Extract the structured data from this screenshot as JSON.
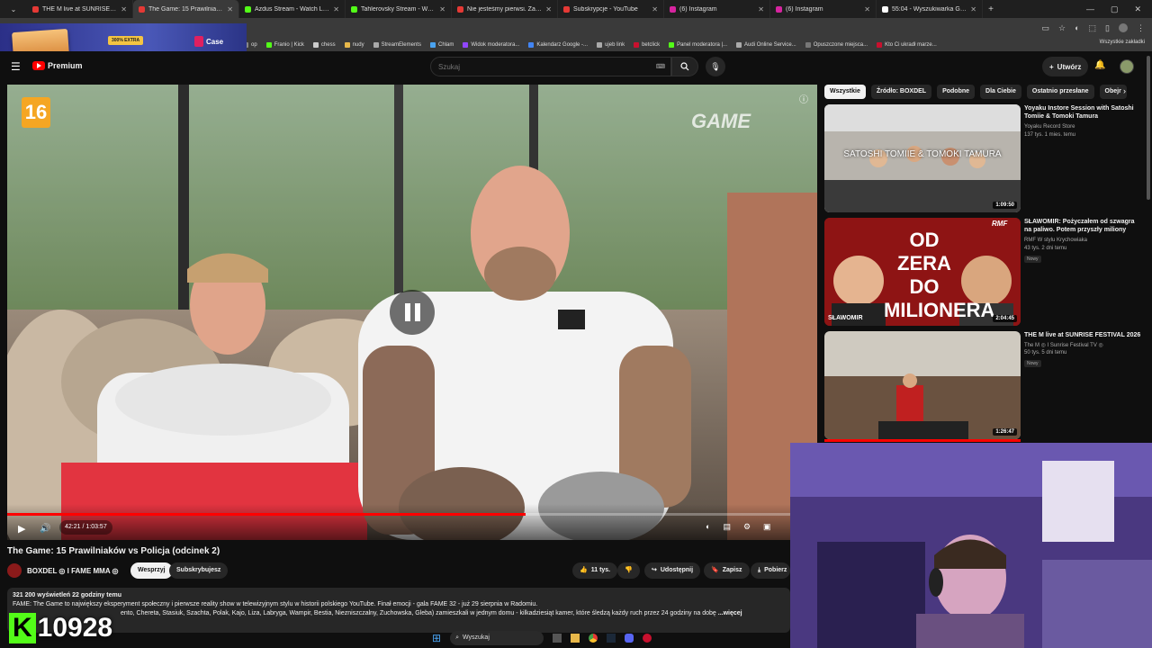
{
  "browser": {
    "tabs": [
      {
        "title": "THE M live at SUNRISE FESTIVAL",
        "color": "#e53935",
        "active": false
      },
      {
        "title": "The Game: 15 Prawilniaków",
        "color": "#e53935",
        "active": true
      },
      {
        "title": "Azdus Stream - Watch Live on",
        "color": "#53fc18",
        "active": false
      },
      {
        "title": "Tahlerovsky Stream - Watch Li",
        "color": "#53fc18",
        "active": false
      },
      {
        "title": "Nie jesteśmy pierwsi. Zaawans",
        "color": "#e53935",
        "active": false
      },
      {
        "title": "Subskrypcje - YouTube",
        "color": "#e53935",
        "active": false
      },
      {
        "title": "(6) Instagram",
        "color": "#d6249f",
        "active": false
      },
      {
        "title": "(6) Instagram",
        "color": "#d6249f",
        "active": false
      },
      {
        "title": "55:04 - Wyszukiwarka Google",
        "color": "#ffffff",
        "active": false
      }
    ],
    "bookmarks": [
      "op",
      "Franio | Kick",
      "chess",
      "nudy",
      "StreamElements",
      "Chlam",
      "Widok moderatora...",
      "Kalendarz Google -...",
      "ujeb link",
      "betclick",
      "Panel moderatora |...",
      "Audi Online Service...",
      "Opuszczone miejsca...",
      "Kto Ci ukradł marze..."
    ],
    "bookmarks_right": "Wszystkie zakładki"
  },
  "ad": {
    "badge": "300% EXTRA",
    "brand": "Case"
  },
  "youtube": {
    "logo": "Premium",
    "search_placeholder": "Szukaj",
    "create_label": "Utwórz"
  },
  "player": {
    "age_rating": "16",
    "watermark": "GAME",
    "time": "42:21 / 1:03:57",
    "progress": 0.662
  },
  "video": {
    "title": "The Game: 15 Prawilniaków vs Policja (odcinek 2)",
    "channel": "BOXDEL ◎ I FAME MMA ◎",
    "support_label": "Wesprzyj",
    "subscribed_label": "Subskrybujesz",
    "likes": "11 tys.",
    "share_label": "Udostępnij",
    "save_label": "Zapisz",
    "download_label": "Pobierz",
    "stats": "321 200 wyświetleń  22 godziny temu",
    "desc_line1": "FAME: The Game to największy eksperyment społeczny i pierwsze reality show w telewizyjnym stylu w historii polskiego YouTube. Finał emocji - gala FAME 32 - już 29 sierpnia w Radomiu.",
    "desc_line2": "ento, Chereta, Stasiuk, Szachta, Polak, Kajo, Liza, Labryga, Wampir, Bestia, Niezniszczalny, Żuchowska, Gleba) zamieszkali w jednym domu - kilkadziesiąt kamer, które śledzą każdy ruch przez 24 godziny na dobę",
    "more": "...więcej"
  },
  "chips": [
    "Wszystkie",
    "Źródło: BOXDEL",
    "Podobne",
    "Dla Ciebie",
    "Ostatnio przesłane",
    "Obejr"
  ],
  "recommendations": [
    {
      "title": "Yoyaku Instore Session with Satoshi Tomiie & Tomoki Tamura",
      "channel": "Yoyaku Record Store",
      "meta": "137 tys.  1 mies. temu",
      "duration": "1:09:50",
      "thumb_text": "SATOSHI TOMIIE & TOMOKI TAMURA",
      "badge": ""
    },
    {
      "title": "SŁAWOMIR: Pożyczałem od szwagra na paliwo. Potem przyszły miliony",
      "channel": "RMF W stylu Krychowiaka",
      "meta": "43 tys.  2 dni temu",
      "duration": "2:04:45",
      "thumb_text": "OD ZERA DO MILIONERA",
      "thumb_caption": "SŁAWOMIR",
      "thumb_logo": "RMF",
      "badge": "Nowy"
    },
    {
      "title": "THE M live at SUNRISE FESTIVAL 2026",
      "channel": "The M ◎ I Sunrise Festival TV ◎",
      "meta": "50 tys.  5 dni temu",
      "duration": "1:26:47",
      "thumb_text": "",
      "badge": "Nowy"
    }
  ],
  "overlay_counter": {
    "letter": "K",
    "value": "10928"
  },
  "taskbar": {
    "search": "Wyszukaj"
  }
}
